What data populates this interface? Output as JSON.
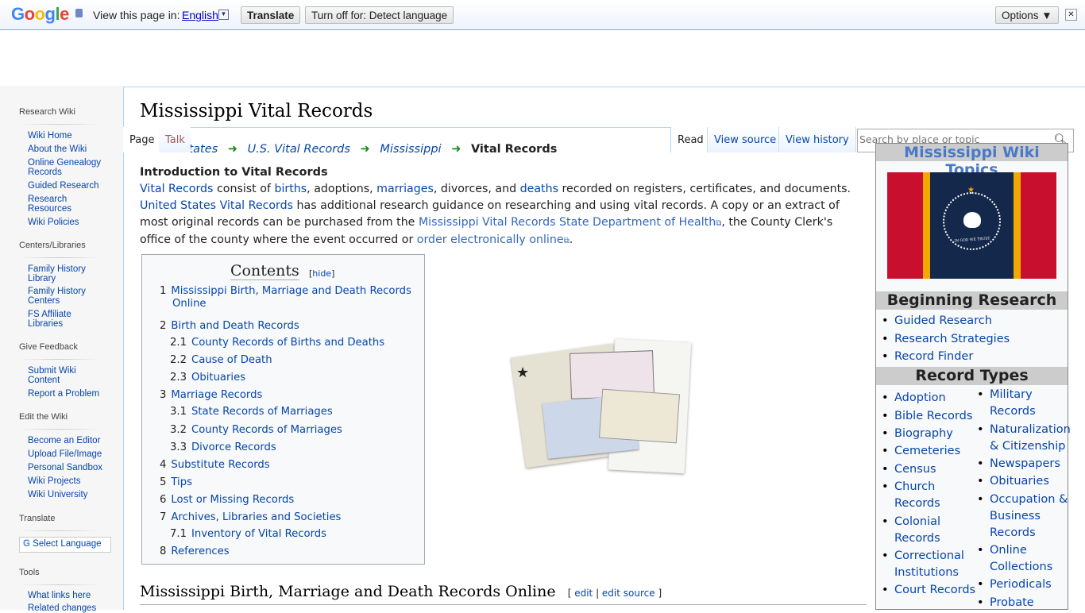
{
  "translate_bar": {
    "logo": "Google",
    "view_label": "View this page in:",
    "language": "English",
    "translate": "Translate",
    "turn_off": "Turn off for: Detect language",
    "options": "Options ▼",
    "close": "✕"
  },
  "sidebar": {
    "sections": [
      {
        "title": "Research Wiki",
        "items": [
          "Wiki Home",
          "About the Wiki",
          "Online Genealogy Records",
          "Guided Research",
          "Research Resources",
          "Wiki Policies"
        ]
      },
      {
        "title": "Centers/Libraries",
        "items": [
          "Family History Library",
          "Family History Centers",
          "FS Affiliate Libraries"
        ]
      },
      {
        "title": "Give Feedback",
        "items": [
          "Submit Wiki Content",
          "Report a Problem"
        ]
      },
      {
        "title": "Edit the Wiki",
        "items": [
          "Become an Editor",
          "Upload File/Image",
          "Personal Sandbox",
          "Wiki Projects",
          "Wiki University"
        ]
      },
      {
        "title": "Translate",
        "items": []
      },
      {
        "title": "Tools",
        "items": [
          "What links here",
          "Related changes"
        ]
      }
    ],
    "select_language": "Select Language"
  },
  "tabs": {
    "page": "Page",
    "talk": "Talk",
    "read": "Read",
    "view_source": "View source",
    "view_history": "View history"
  },
  "search": {
    "placeholder": "Search by place or topic"
  },
  "page_title": "Mississippi Vital Records",
  "breadcrumb": [
    "United States",
    "U.S. Vital Records",
    "Mississippi",
    "Vital Records"
  ],
  "intro": {
    "heading": "Introduction to Vital Records",
    "p1": [
      "Vital Records",
      " consist of ",
      "births",
      ", adoptions, ",
      "marriages",
      ", divorces, and ",
      "deaths",
      " recorded on registers, certificates, and documents."
    ],
    "p2": [
      "United States Vital Records",
      " has additional research guidance on researching and using vital records. A copy or an extract of most original records can be purchased from the ",
      "Mississippi Vital Records State Department of Health",
      ", the County Clerk's office of the county where the event occurred or ",
      "order electronically online",
      "."
    ]
  },
  "toc": {
    "title": "Contents",
    "hide": "hide",
    "items": [
      {
        "num": "1",
        "label": "Mississippi Birth, Marriage and Death Records Online"
      },
      {
        "num": "2",
        "label": "Birth and Death Records"
      },
      {
        "num": "2.1",
        "label": "County Records of Births and Deaths"
      },
      {
        "num": "2.2",
        "label": "Cause of Death"
      },
      {
        "num": "2.3",
        "label": "Obituaries"
      },
      {
        "num": "3",
        "label": "Marriage Records"
      },
      {
        "num": "3.1",
        "label": "State Records of Marriages"
      },
      {
        "num": "3.2",
        "label": "County Records of Marriages"
      },
      {
        "num": "3.3",
        "label": "Divorce Records"
      },
      {
        "num": "4",
        "label": "Substitute Records"
      },
      {
        "num": "5",
        "label": "Tips"
      },
      {
        "num": "6",
        "label": "Lost or Missing Records"
      },
      {
        "num": "7",
        "label": "Archives, Libraries and Societies"
      },
      {
        "num": "7.1",
        "label": "Inventory of Vital Records"
      },
      {
        "num": "8",
        "label": "References"
      }
    ]
  },
  "section1": {
    "title": "Mississippi Birth, Marriage and Death Records Online",
    "edit": "edit",
    "edit_source": "edit source"
  },
  "right_box": {
    "title": "Mississippi Wiki Topics",
    "flag_motto": "IN GOD WE TRUST",
    "beginning": {
      "title": "Beginning Research",
      "items": [
        "Guided Research",
        "Research Strategies",
        "Record Finder"
      ]
    },
    "record_types": {
      "title": "Record Types",
      "col1": [
        "Adoption",
        "Bible Records",
        "Biography",
        "Cemeteries",
        "Census",
        "Church Records",
        "Colonial Records",
        "Correctional Institutions",
        "Court Records"
      ],
      "col2": [
        "Military Records",
        "Naturalization & Citizenship",
        "Newspapers",
        "Obituaries",
        "Occupation & Business Records",
        "Online Collections",
        "Periodicals",
        "Probate"
      ]
    }
  },
  "colors": {
    "link": "#0645ad",
    "arrow": "#1a8a1a",
    "header_grey": "#cccccc",
    "flag_red": "#c8102e",
    "flag_gold": "#f2a900",
    "flag_blue": "#14284b"
  }
}
